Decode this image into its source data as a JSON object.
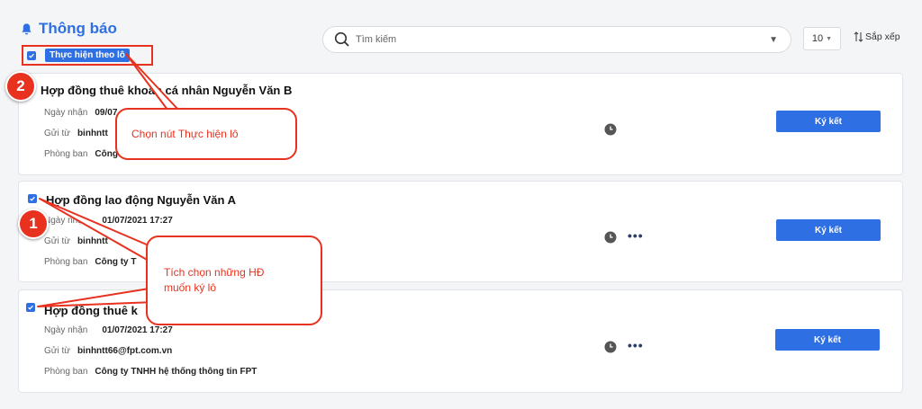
{
  "header": {
    "title": "Thông báo"
  },
  "batch": {
    "button_label": "Thực hiện theo lô"
  },
  "search": {
    "placeholder": "Tìm kiếm"
  },
  "toolbar": {
    "page_size": "10",
    "sort_label": "Sắp xếp"
  },
  "cards": [
    {
      "title": "Hợp đồng thuê khoán cá nhân Nguyễn Văn B",
      "received_label": "Ngày nhận",
      "received_value": "09/07",
      "from_label": "Gửi từ",
      "from_value": "binhntt",
      "dept_label": "Phòng ban",
      "dept_value": "Công",
      "sign_label": "Ký kết"
    },
    {
      "title": "Hợp đồng lao động Nguyễn Văn A",
      "received_label": "Ngày nhận",
      "received_value": "01/07/2021 17:27",
      "from_label": "Gửi từ",
      "from_value": "binhntt",
      "dept_label": "Phòng ban",
      "dept_value": "Công ty T",
      "sign_label": "Ký kết"
    },
    {
      "title": "Hợp đồng thuê k",
      "received_label": "Ngày nhận",
      "received_value": "01/07/2021 17:27",
      "from_label": "Gửi từ",
      "from_value": "binhntt66@fpt.com.vn",
      "dept_label": "Phòng ban",
      "dept_value": "Công ty TNHH hệ thống thông tin FPT",
      "sign_label": "Ký kết"
    }
  ],
  "annotations": {
    "badge_1": "1",
    "badge_2": "2",
    "callout_batch": "Chọn nút Thực hiện lô",
    "callout_select": "Tích chọn những HĐ muốn ký lô"
  },
  "icons": {
    "bell": "bell-icon",
    "search": "search-icon",
    "sort": "sort-icon",
    "clock": "clock-icon",
    "more": "more-icon",
    "check": "check-icon"
  },
  "colors": {
    "accent": "#2f6fe4",
    "annotation": "#e8321f"
  }
}
